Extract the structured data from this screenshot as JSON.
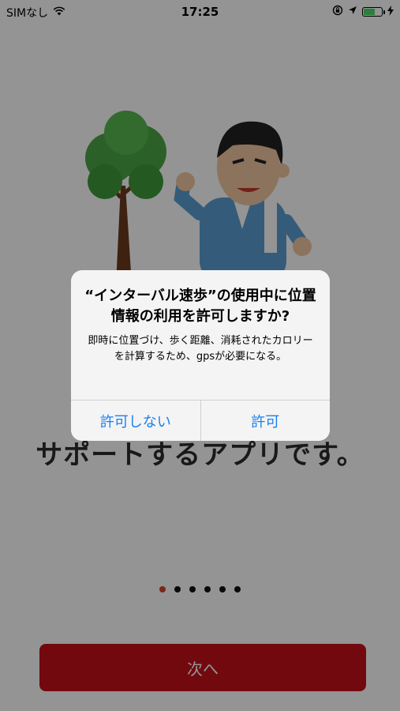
{
  "status_bar": {
    "carrier": "SIMなし",
    "time": "17:25",
    "wifi_icon": "wifi-icon",
    "location_icon": "location-arrow-icon",
    "rotation_lock_icon": "rotation-lock-icon",
    "battery_icon": "battery-icon",
    "charging_icon": "charging-bolt-icon"
  },
  "main": {
    "text": "サポートするアプリです。"
  },
  "pager": {
    "count": 6,
    "active_index": 0
  },
  "next_button": {
    "label": "次へ"
  },
  "alert": {
    "title": "“インターバル速歩”の使用中に位置情報の利用を許可しますか?",
    "message": "即時に位置づけ、歩く距離、消耗されたカロリーを計算するため、gpsが必要になる。",
    "deny_label": "許可しない",
    "allow_label": "許可"
  },
  "colors": {
    "accent_red": "#c5101b",
    "active_dot": "#d0452a",
    "ios_blue": "#1a7ff0",
    "battery_green": "#4cd964"
  }
}
